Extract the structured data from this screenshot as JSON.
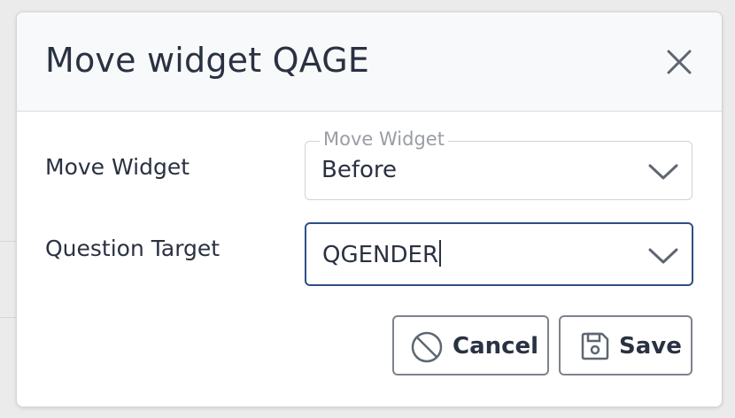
{
  "modal": {
    "title": "Move widget QAGE"
  },
  "form": {
    "move_widget": {
      "label": "Move Widget",
      "floating_label": "Move Widget",
      "value": "Before"
    },
    "question_target": {
      "label": "Question Target",
      "value": "QGENDER"
    }
  },
  "buttons": {
    "cancel_label": "Cancel",
    "save_label": "Save"
  },
  "icons": {
    "close": "close-icon",
    "chevron": "chevron-down-icon",
    "cancel": "ban-icon",
    "save": "floppy-disk-icon"
  },
  "colors": {
    "focus_border": "#2f4e85",
    "text": "#2a3142",
    "muted": "#9a9da3",
    "header_bg": "#f8f9fa"
  }
}
